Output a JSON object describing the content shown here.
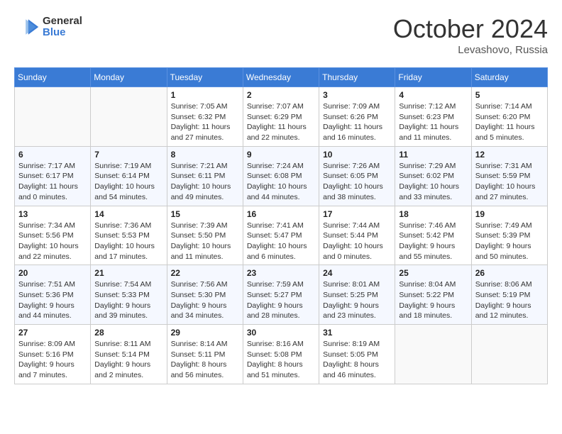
{
  "header": {
    "logo_general": "General",
    "logo_blue": "Blue",
    "month_title": "October 2024",
    "location": "Levashovo, Russia"
  },
  "weekdays": [
    "Sunday",
    "Monday",
    "Tuesday",
    "Wednesday",
    "Thursday",
    "Friday",
    "Saturday"
  ],
  "weeks": [
    [
      {
        "day": "",
        "info": ""
      },
      {
        "day": "",
        "info": ""
      },
      {
        "day": "1",
        "info": "Sunrise: 7:05 AM\nSunset: 6:32 PM\nDaylight: 11 hours and 27 minutes."
      },
      {
        "day": "2",
        "info": "Sunrise: 7:07 AM\nSunset: 6:29 PM\nDaylight: 11 hours and 22 minutes."
      },
      {
        "day": "3",
        "info": "Sunrise: 7:09 AM\nSunset: 6:26 PM\nDaylight: 11 hours and 16 minutes."
      },
      {
        "day": "4",
        "info": "Sunrise: 7:12 AM\nSunset: 6:23 PM\nDaylight: 11 hours and 11 minutes."
      },
      {
        "day": "5",
        "info": "Sunrise: 7:14 AM\nSunset: 6:20 PM\nDaylight: 11 hours and 5 minutes."
      }
    ],
    [
      {
        "day": "6",
        "info": "Sunrise: 7:17 AM\nSunset: 6:17 PM\nDaylight: 11 hours and 0 minutes."
      },
      {
        "day": "7",
        "info": "Sunrise: 7:19 AM\nSunset: 6:14 PM\nDaylight: 10 hours and 54 minutes."
      },
      {
        "day": "8",
        "info": "Sunrise: 7:21 AM\nSunset: 6:11 PM\nDaylight: 10 hours and 49 minutes."
      },
      {
        "day": "9",
        "info": "Sunrise: 7:24 AM\nSunset: 6:08 PM\nDaylight: 10 hours and 44 minutes."
      },
      {
        "day": "10",
        "info": "Sunrise: 7:26 AM\nSunset: 6:05 PM\nDaylight: 10 hours and 38 minutes."
      },
      {
        "day": "11",
        "info": "Sunrise: 7:29 AM\nSunset: 6:02 PM\nDaylight: 10 hours and 33 minutes."
      },
      {
        "day": "12",
        "info": "Sunrise: 7:31 AM\nSunset: 5:59 PM\nDaylight: 10 hours and 27 minutes."
      }
    ],
    [
      {
        "day": "13",
        "info": "Sunrise: 7:34 AM\nSunset: 5:56 PM\nDaylight: 10 hours and 22 minutes."
      },
      {
        "day": "14",
        "info": "Sunrise: 7:36 AM\nSunset: 5:53 PM\nDaylight: 10 hours and 17 minutes."
      },
      {
        "day": "15",
        "info": "Sunrise: 7:39 AM\nSunset: 5:50 PM\nDaylight: 10 hours and 11 minutes."
      },
      {
        "day": "16",
        "info": "Sunrise: 7:41 AM\nSunset: 5:47 PM\nDaylight: 10 hours and 6 minutes."
      },
      {
        "day": "17",
        "info": "Sunrise: 7:44 AM\nSunset: 5:44 PM\nDaylight: 10 hours and 0 minutes."
      },
      {
        "day": "18",
        "info": "Sunrise: 7:46 AM\nSunset: 5:42 PM\nDaylight: 9 hours and 55 minutes."
      },
      {
        "day": "19",
        "info": "Sunrise: 7:49 AM\nSunset: 5:39 PM\nDaylight: 9 hours and 50 minutes."
      }
    ],
    [
      {
        "day": "20",
        "info": "Sunrise: 7:51 AM\nSunset: 5:36 PM\nDaylight: 9 hours and 44 minutes."
      },
      {
        "day": "21",
        "info": "Sunrise: 7:54 AM\nSunset: 5:33 PM\nDaylight: 9 hours and 39 minutes."
      },
      {
        "day": "22",
        "info": "Sunrise: 7:56 AM\nSunset: 5:30 PM\nDaylight: 9 hours and 34 minutes."
      },
      {
        "day": "23",
        "info": "Sunrise: 7:59 AM\nSunset: 5:27 PM\nDaylight: 9 hours and 28 minutes."
      },
      {
        "day": "24",
        "info": "Sunrise: 8:01 AM\nSunset: 5:25 PM\nDaylight: 9 hours and 23 minutes."
      },
      {
        "day": "25",
        "info": "Sunrise: 8:04 AM\nSunset: 5:22 PM\nDaylight: 9 hours and 18 minutes."
      },
      {
        "day": "26",
        "info": "Sunrise: 8:06 AM\nSunset: 5:19 PM\nDaylight: 9 hours and 12 minutes."
      }
    ],
    [
      {
        "day": "27",
        "info": "Sunrise: 8:09 AM\nSunset: 5:16 PM\nDaylight: 9 hours and 7 minutes."
      },
      {
        "day": "28",
        "info": "Sunrise: 8:11 AM\nSunset: 5:14 PM\nDaylight: 9 hours and 2 minutes."
      },
      {
        "day": "29",
        "info": "Sunrise: 8:14 AM\nSunset: 5:11 PM\nDaylight: 8 hours and 56 minutes."
      },
      {
        "day": "30",
        "info": "Sunrise: 8:16 AM\nSunset: 5:08 PM\nDaylight: 8 hours and 51 minutes."
      },
      {
        "day": "31",
        "info": "Sunrise: 8:19 AM\nSunset: 5:05 PM\nDaylight: 8 hours and 46 minutes."
      },
      {
        "day": "",
        "info": ""
      },
      {
        "day": "",
        "info": ""
      }
    ]
  ]
}
